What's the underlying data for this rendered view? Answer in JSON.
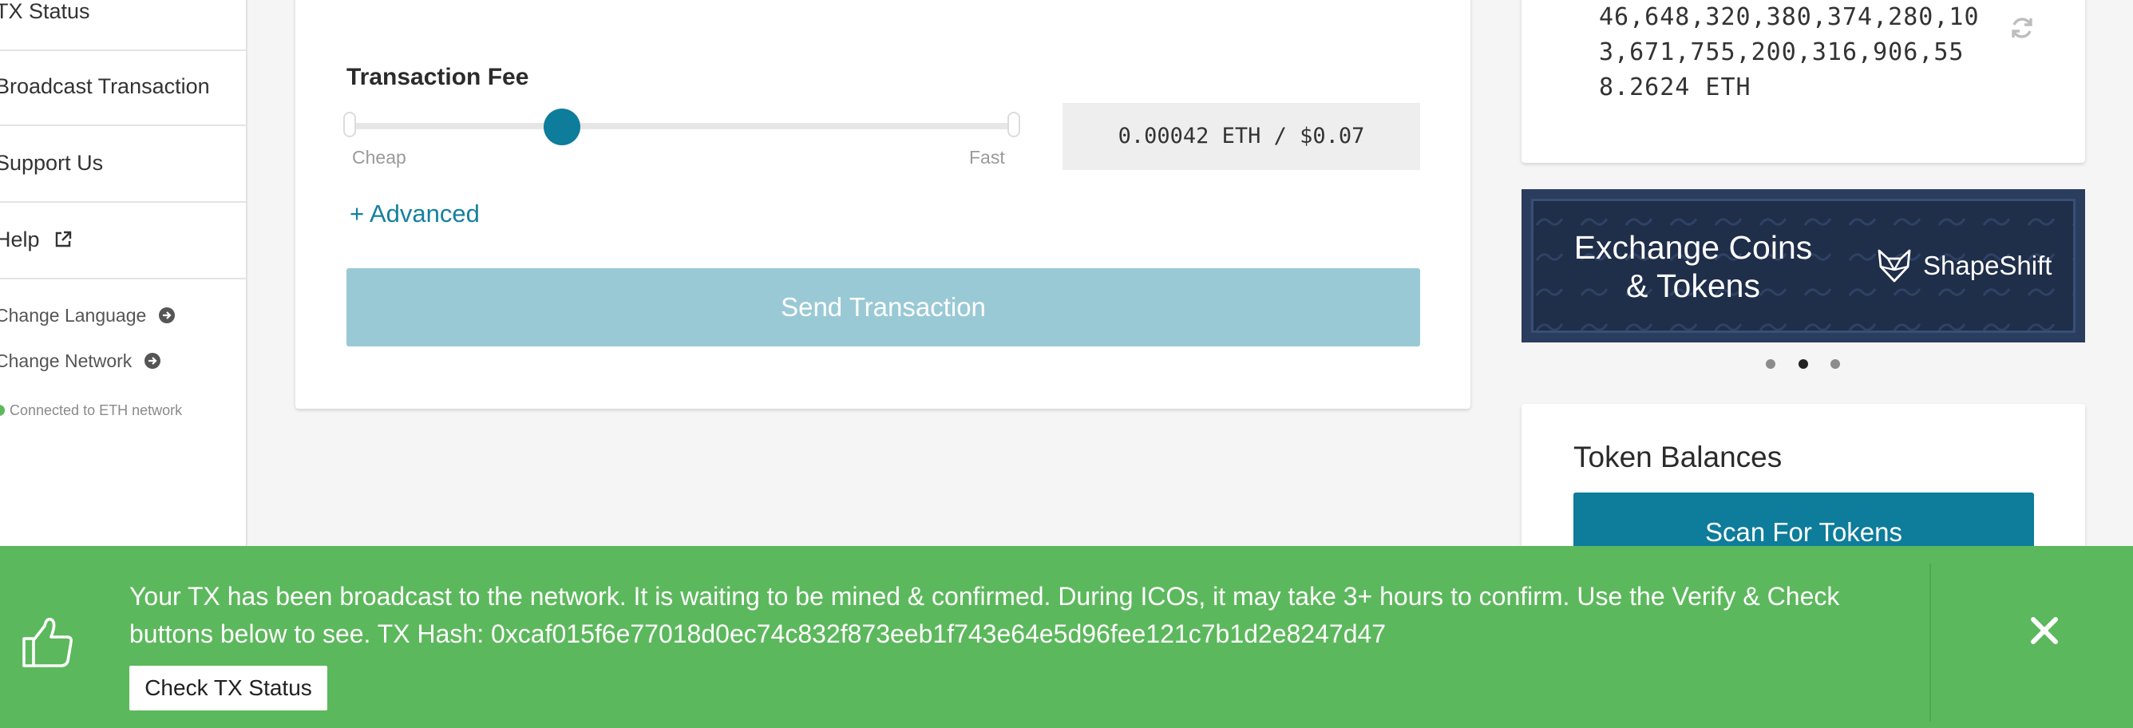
{
  "sidebar": {
    "items": [
      {
        "label": "TX Status"
      },
      {
        "label": "Broadcast Transaction"
      },
      {
        "label": "Support Us"
      },
      {
        "label": "Help",
        "icon": "external-link-icon"
      }
    ],
    "links": [
      {
        "label": "Change Language",
        "icon": "arrow-circle-right-icon"
      },
      {
        "label": "Change Network",
        "icon": "arrow-circle-right-icon"
      }
    ],
    "network_status": "Connected to ETH network",
    "status_color": "#5cb85c"
  },
  "main": {
    "fee_title": "Transaction Fee",
    "fee_level": 0.32,
    "slider_min_label": "Cheap",
    "slider_max_label": "Fast",
    "fee_value": "0.00042 ETH / $0.07",
    "advanced_link": "+ Advanced",
    "send_button": "Send Transaction"
  },
  "balance": {
    "lines": [
      "46,648,320,380,374,280,10",
      "3,671,755,200,316,906,55",
      "8.2624 ETH"
    ],
    "refresh_icon": "refresh-icon"
  },
  "banner": {
    "title_line1": "Exchange Coins",
    "title_line2": "& Tokens",
    "brand": "ShapeShift",
    "brand_icon": "shapeshift-fox-icon",
    "carousel_active": 1,
    "carousel_count": 3
  },
  "tokens": {
    "title": "Token Balances",
    "scan_button": "Scan For Tokens"
  },
  "alert": {
    "message_line1": "Your TX has been broadcast to the network. It is waiting to be mined & confirmed. During ICOs, it may take 3+ hours to confirm. Use the Verify & Check",
    "message_line2": "buttons below to see. TX Hash: 0xcaf015f6e77018d0ec74c832f873eeb1f743e64e5d96fee121c7b1d2e8247d47",
    "button": "Check TX Status",
    "icon": "thumbs-up-icon",
    "color": "#5cb85c"
  },
  "colors": {
    "accent": "#0e7c9b",
    "link": "#16809e",
    "send_disabled": "#9ac9d6",
    "banner_bg": "#2a3d5e"
  }
}
